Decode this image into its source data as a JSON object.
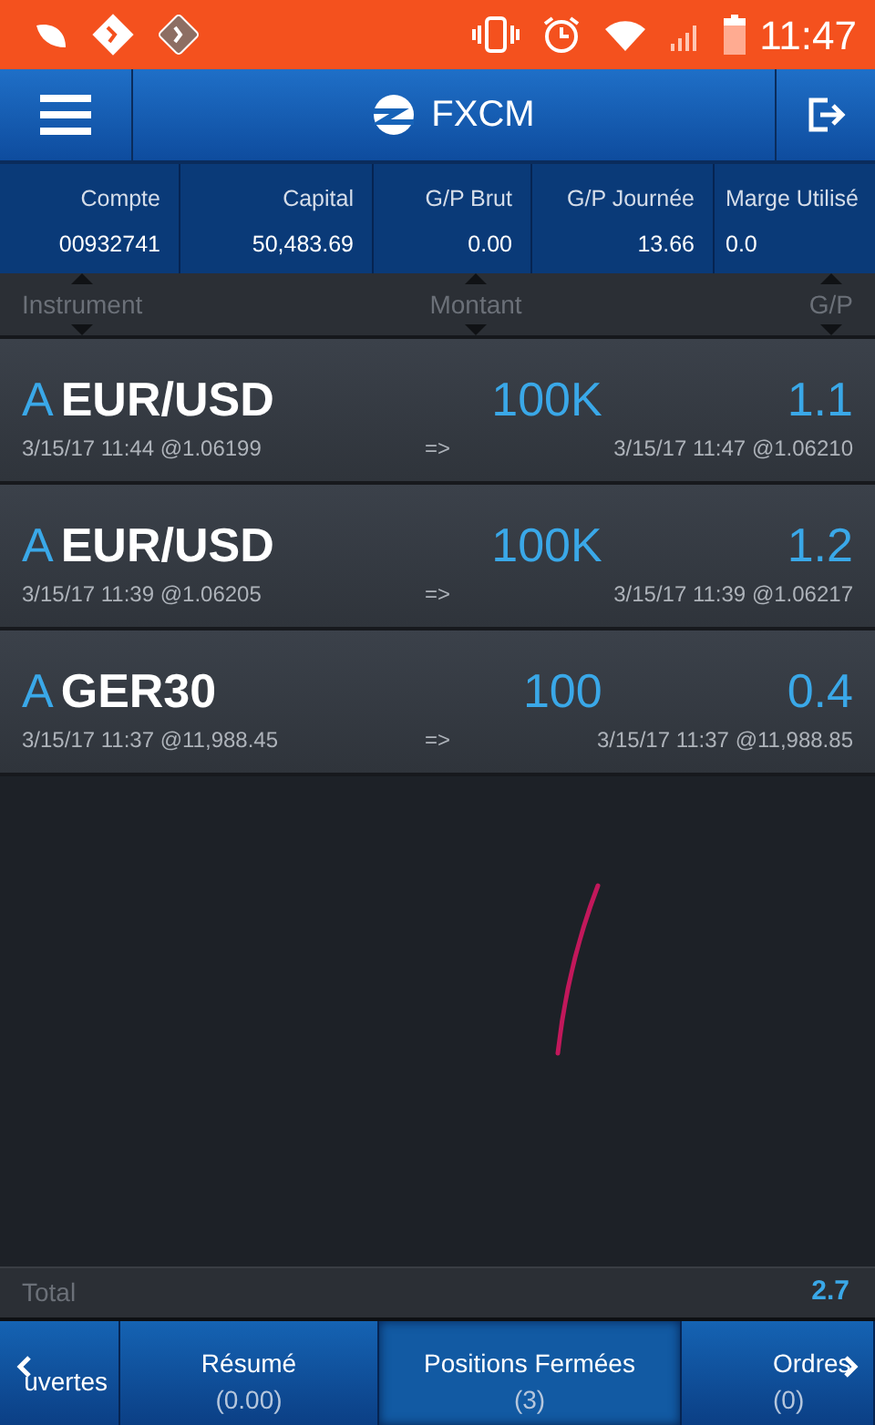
{
  "status_bar": {
    "time": "11:47"
  },
  "header": {
    "title": "FXCM"
  },
  "summary": [
    {
      "label": "Compte",
      "value": "00932741"
    },
    {
      "label": "Capital",
      "value": "50,483.69"
    },
    {
      "label": "G/P Brut",
      "value": "0.00"
    },
    {
      "label": "G/P Journée",
      "value": "13.66"
    },
    {
      "label": "Marge Utilisé",
      "value": "0.0"
    }
  ],
  "table": {
    "columns": [
      "Instrument",
      "Montant",
      "G/P"
    ],
    "rows": [
      {
        "side": "A",
        "instrument": "EUR/USD",
        "amount": "100K",
        "pl": "1.1",
        "open": "3/15/17 11:44 @1.06199",
        "arrow": "=>",
        "close": "3/15/17 11:47 @1.06210"
      },
      {
        "side": "A",
        "instrument": "EUR/USD",
        "amount": "100K",
        "pl": "1.2",
        "open": "3/15/17 11:39 @1.06205",
        "arrow": "=>",
        "close": "3/15/17 11:39 @1.06217"
      },
      {
        "side": "A",
        "instrument": "GER30",
        "amount": "100",
        "pl": "0.4",
        "open": "3/15/17 11:37 @11,988.45",
        "arrow": "=>",
        "close": "3/15/17 11:37 @11,988.85"
      }
    ]
  },
  "total": {
    "label": "Total",
    "value": "2.7"
  },
  "tabs": [
    {
      "label": "uvertes",
      "selected": false
    },
    {
      "label": "Résumé",
      "count": "(0.00)",
      "selected": false
    },
    {
      "label": "Positions Fermées",
      "count": "(3)",
      "selected": true
    },
    {
      "label": "Ordres",
      "count": "(0)",
      "selected": false
    }
  ]
}
